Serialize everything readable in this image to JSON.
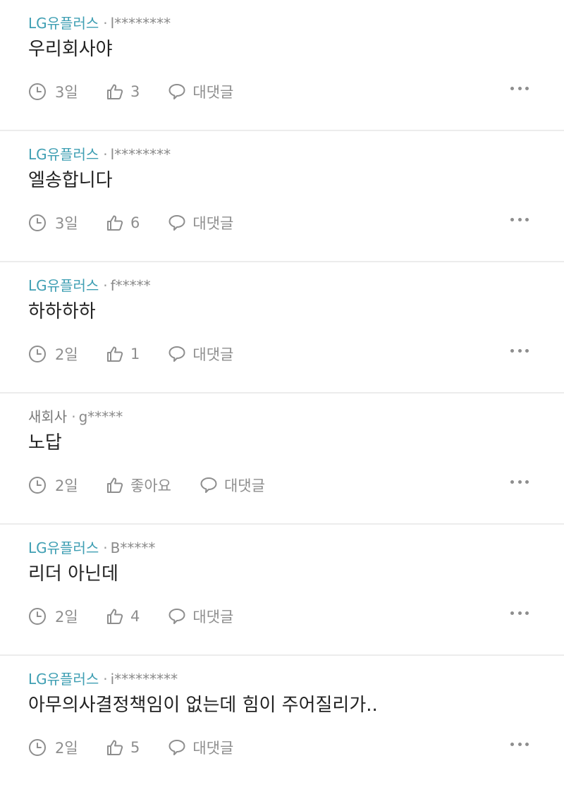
{
  "colors": {
    "company_link": "#3f9fb3",
    "company_plain": "#7a7a7a",
    "meta_gray": "#8e8e8e",
    "divider": "#ececec"
  },
  "icons": {
    "time": "clock-icon",
    "like": "thumbs-up-icon",
    "reply": "speech-bubble-icon",
    "more": "more-dots-icon"
  },
  "separator": "·",
  "comments": [
    {
      "company": "LG유플러스",
      "user": "l********",
      "text": "우리회사야",
      "time": "3일",
      "likes": "3",
      "reply_label": "대댓글"
    },
    {
      "company": "LG유플러스",
      "user": "l********",
      "text": "엘송합니다",
      "time": "3일",
      "likes": "6",
      "reply_label": "대댓글"
    },
    {
      "company": "LG유플러스",
      "user": "f*****",
      "text": "하하하하",
      "time": "2일",
      "likes": "1",
      "reply_label": "대댓글"
    },
    {
      "company": "새회사",
      "user": "g*****",
      "text": "노답",
      "time": "2일",
      "likes": "좋아요",
      "reply_label": "대댓글"
    },
    {
      "company": "LG유플러스",
      "user": "B*****",
      "text": "리더 아닌데",
      "time": "2일",
      "likes": "4",
      "reply_label": "대댓글"
    },
    {
      "company": "LG유플러스",
      "user": "i*********",
      "text": "아무의사결정책임이 없는데 힘이 주어질리가..",
      "time": "2일",
      "likes": "5",
      "reply_label": "대댓글"
    }
  ]
}
